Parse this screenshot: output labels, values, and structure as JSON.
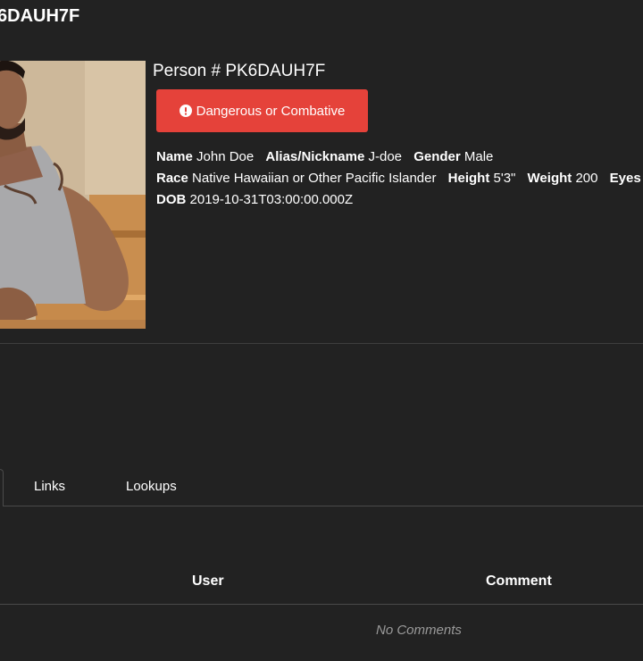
{
  "header": {
    "title": "6DAUH7F"
  },
  "person": {
    "title": "Person # PK6DAUH7F",
    "alert_label": "Dangerous or Combative",
    "alert_color": "#e5423a",
    "fields": {
      "name_label": "Name",
      "name_value": "John Doe",
      "alias_label": "Alias/Nickname",
      "alias_value": "J-doe",
      "gender_label": "Gender",
      "gender_value": "Male",
      "race_label": "Race",
      "race_value": "Native Hawaiian or Other Pacific Islander",
      "height_label": "Height",
      "height_value": "5'3\"",
      "weight_label": "Weight",
      "weight_value": "200",
      "eyes_label": "Eyes",
      "dob_label": "DOB",
      "dob_value": "2019-10-31T03:00:00.000Z"
    }
  },
  "tabs": [
    {
      "label": ""
    },
    {
      "label": "Links"
    },
    {
      "label": "Lookups"
    }
  ],
  "comments": {
    "columns": [
      "User",
      "Comment"
    ],
    "empty_text": "No Comments"
  },
  "icons": {
    "alert": "exclamation-circle-icon"
  },
  "colors": {
    "background": "#222222",
    "divider": "#3e3e3e"
  }
}
